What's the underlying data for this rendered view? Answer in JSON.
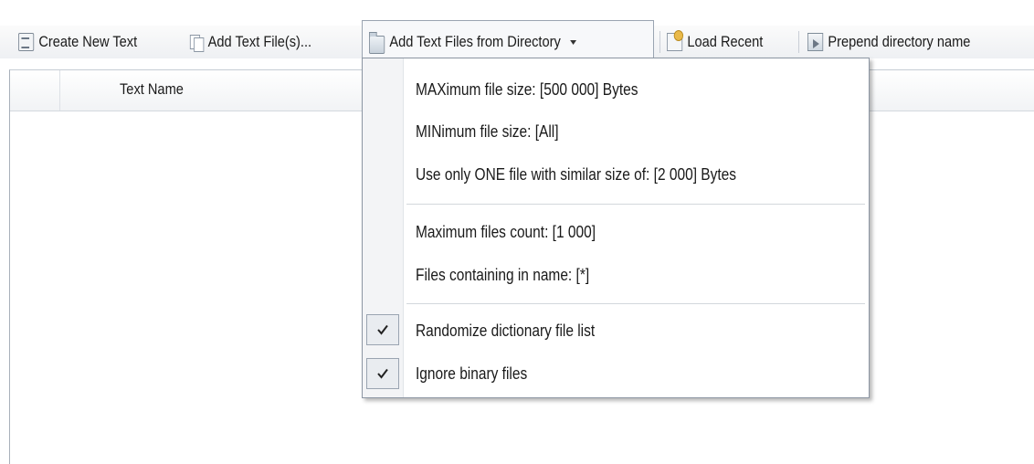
{
  "toolbar": {
    "create_new_text": "Create New Text",
    "add_text_files": "Add Text File(s)...",
    "add_from_directory": "Add Text Files from Directory",
    "load_recent": "Load Recent",
    "prepend_directory": "Prepend directory name"
  },
  "list": {
    "column_header": "Text Name"
  },
  "menu": {
    "max_file_size": "MAXimum file size: [500 000] Bytes",
    "min_file_size": "MINimum file size: [All]",
    "one_file_similar_size": "Use only ONE file with similar size of: [2 000] Bytes",
    "max_files_count": "Maximum files count: [1 000]",
    "files_containing_name": "Files containing in name: [*]",
    "randomize_list": "Randomize dictionary file list",
    "randomize_checked": true,
    "ignore_binary": "Ignore binary files",
    "ignore_binary_checked": true
  },
  "icons": {
    "create": "create-text-icon",
    "add_files": "add-files-icon",
    "folder": "folder-icon",
    "recent": "load-recent-icon",
    "prepend": "prepend-icon",
    "dropdown": "chevron-down-icon",
    "check": "check-icon"
  }
}
